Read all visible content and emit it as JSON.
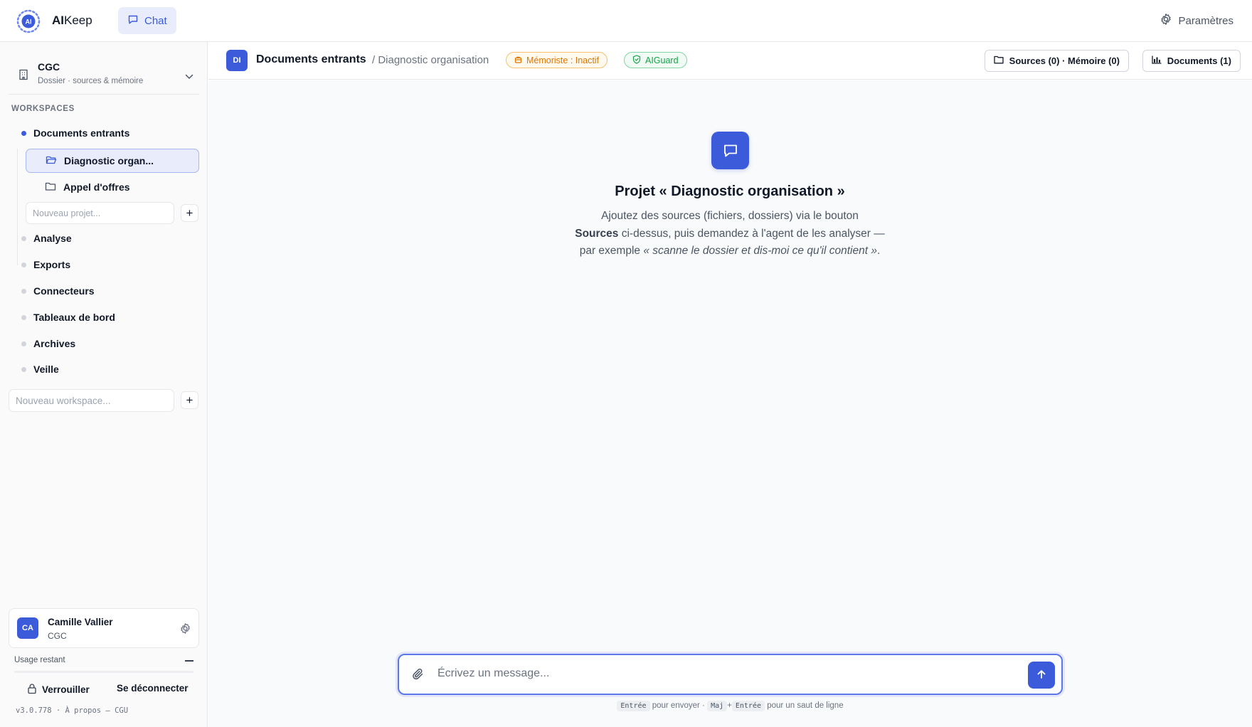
{
  "brand": {
    "prefix": "AI",
    "suffix": "Keep",
    "logo_text": "AI"
  },
  "nav": {
    "chat_label": "Chat"
  },
  "settings_label": "Paramètres",
  "org": {
    "name": "CGC",
    "subtitle": "Dossier · sources & mémoire"
  },
  "sidebar": {
    "section_label": "WORKSPACES",
    "active_workspace": "Documents entrants",
    "projects": [
      {
        "label": "Diagnostic organ...",
        "selected": true
      },
      {
        "label": "Appel d'offres",
        "selected": false
      }
    ],
    "new_project_placeholder": "Nouveau projet...",
    "workspaces": [
      "Analyse",
      "Exports",
      "Connecteurs",
      "Tableaux de bord",
      "Archives",
      "Veille"
    ],
    "new_workspace_placeholder": "Nouveau workspace..."
  },
  "user": {
    "initials": "CA",
    "name": "Camille Vallier",
    "org": "CGC",
    "usage_label": "Usage restant",
    "usage_fraction": 0.0,
    "lock_label": "Verrouiller",
    "logout_label": "Se déconnecter",
    "version": "v3.0.778 · À propos — CGU"
  },
  "header": {
    "badge": "DI",
    "title": "Documents entrants",
    "crumb": "/ Diagnostic organisation",
    "memorist_status": "Mémoriste : Inactif",
    "guard_label": "AIGuard",
    "sources_button": "Sources (0) · Mémoire (0)",
    "documents_button": "Documents (1)"
  },
  "hero": {
    "title": "Projet « Diagnostic organisation »",
    "line1": "Ajoutez des sources (fichiers, dossiers) via le bouton",
    "sources_word": "Sources",
    "line2": " ci-dessus, puis demandez à l'agent de les analyser — par exemple ",
    "example": "« scanne le dossier et dis-moi ce qu'il contient »",
    "end": "."
  },
  "composer": {
    "placeholder": "Écrivez un message...",
    "hint_key1": "Entrée",
    "hint_text1": "pour envoyer ·",
    "hint_key2": "Maj",
    "hint_plus": "+",
    "hint_key3": "Entrée",
    "hint_text2": "pour un saut de ligne"
  },
  "colors": {
    "accent": "#3b5bdb",
    "warning": "#d97706",
    "success": "#16a34a"
  }
}
